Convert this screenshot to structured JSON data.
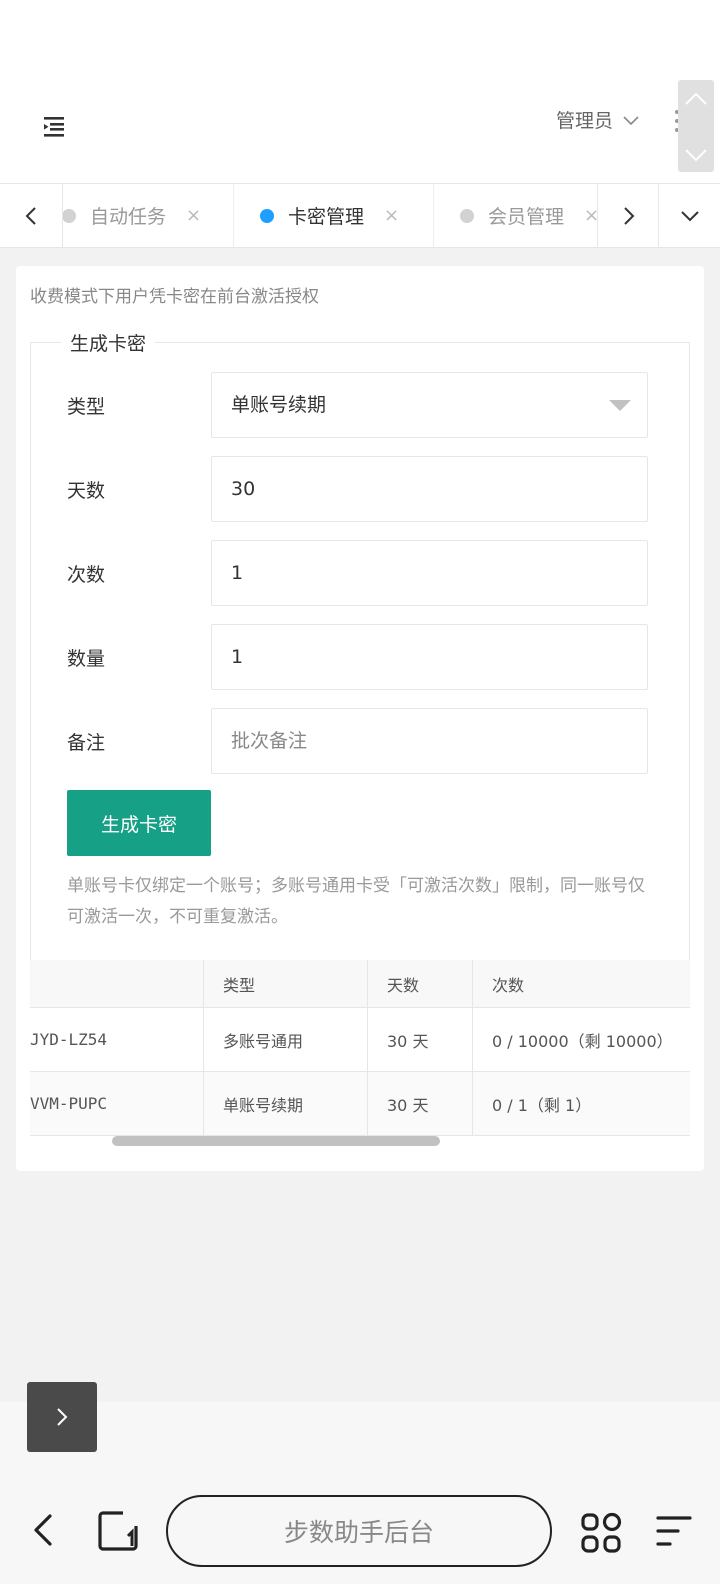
{
  "header": {
    "user_label": "管理员"
  },
  "tabs": [
    {
      "label": "自动任务",
      "close": "×",
      "active": false
    },
    {
      "label": "卡密管理",
      "close": "×",
      "active": true
    },
    {
      "label": "会员管理",
      "close": "×",
      "active": false
    }
  ],
  "page": {
    "tip": "收费模式下用户凭卡密在前台激活授权"
  },
  "form": {
    "legend": "生成卡密",
    "type_label": "类型",
    "type_value": "单账号续期",
    "days_label": "天数",
    "days_value": "30",
    "times_label": "次数",
    "times_value": "1",
    "quantity_label": "数量",
    "quantity_value": "1",
    "remark_label": "备注",
    "remark_placeholder": "批次备注",
    "submit_label": "生成卡密",
    "note": "单账号卡仅绑定一个账号；多账号通用卡受「可激活次数」限制，同一账号仅可激活一次，不可重复激活。"
  },
  "table": {
    "columns": [
      "",
      "类型",
      "天数",
      "次数"
    ],
    "rows": [
      [
        "JYD-LZ54",
        "多账号通用",
        "30 天",
        "0 / 10000（剩 10000）"
      ],
      [
        "VVM-PUPC",
        "单账号续期",
        "30 天",
        "0 / 1（剩 1）"
      ]
    ]
  },
  "browser": {
    "title": "步数助手后台"
  },
  "colors": {
    "primary": "#16a085",
    "tab_active_dot": "#1e9fff"
  }
}
